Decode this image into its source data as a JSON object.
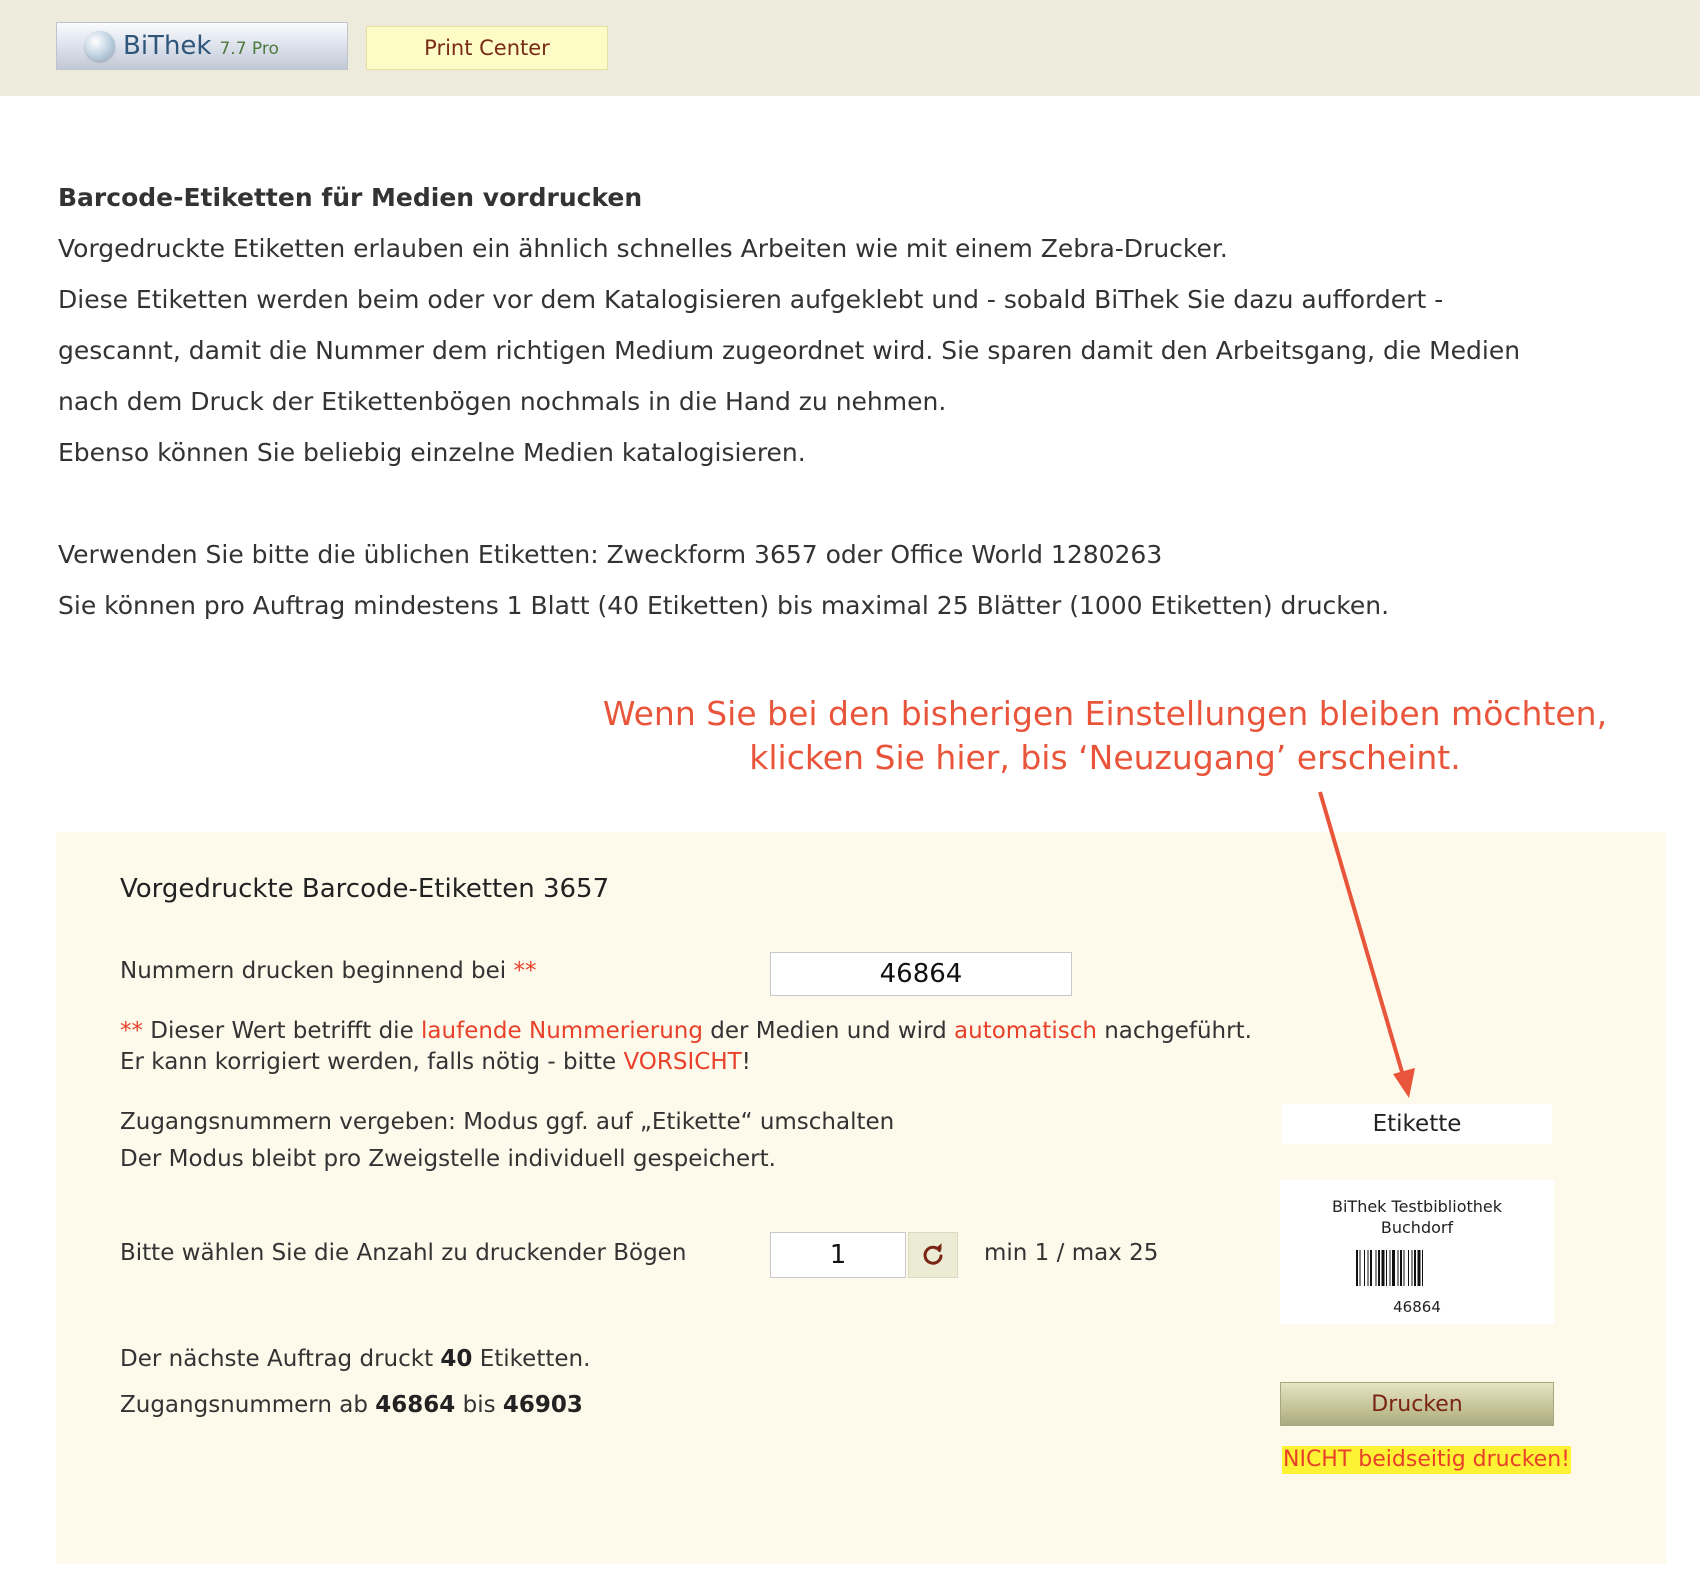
{
  "header": {
    "logo_name": "BiThek",
    "logo_version": "7.7 Pro",
    "print_center_label": "Print Center"
  },
  "intro": {
    "heading": "Barcode-Etiketten für Medien vordrucken",
    "line1": "Vorgedruckte Etiketten erlauben ein ähnlich schnelles Arbeiten wie mit einem Zebra-Drucker.",
    "line2": "Diese Etiketten werden beim oder vor dem Katalogisieren aufgeklebt und - sobald BiThek Sie dazu auffordert -",
    "line3": "gescannt, damit die Nummer dem richtigen Medium zugeordnet wird. Sie sparen damit den Arbeitsgang, die Medien",
    "line4": "nach dem Druck der Etikettenbögen nochmals in die Hand zu nehmen.",
    "line5": "Ebenso können Sie beliebig einzelne Medien katalogisieren.",
    "line6": "Verwenden Sie bitte die üblichen Etiketten: Zweckform 3657 oder Office World 1280263",
    "line7": "Sie können pro Auftrag mindestens 1 Blatt (40 Etiketten) bis maximal 25 Blätter (1000 Etiketten) drucken."
  },
  "callout": {
    "line1": "Wenn Sie bei den bisherigen Einstellungen bleiben möchten,",
    "line2": "klicken Sie hier, bis ‘Neuzugang’ erscheint."
  },
  "panel": {
    "title": "Vorgedruckte Barcode-Etiketten 3657",
    "start_label": "Nummern drucken beginnend bei",
    "stars": "**",
    "start_value": "46864",
    "note": {
      "stars": "**",
      "part1": " Dieser Wert betrifft die ",
      "highlight1": "laufende Nummerierung",
      "part2": " der Medien und wird ",
      "highlight2": "automatisch",
      "part3": " nachgeführt.",
      "line2_part1": "Er kann korrigiert werden, falls nötig - bitte ",
      "line2_highlight": "VORSICHT",
      "line2_part2": "!"
    },
    "mode_line1": "Zugangsnummern vergeben: Modus ggf. auf „Etikette“ umschalten",
    "mode_line2": "Der Modus bleibt pro Zweigstelle individuell gespeichert.",
    "mode_value": "Etikette",
    "preview": {
      "library_line1": "BiThek Testbibliothek",
      "library_line2": "Buchdorf",
      "number": "46864"
    },
    "count_label": "Bitte wählen Sie die Anzahl zu druckender Bögen",
    "count_value": "1",
    "minmax": "min 1 / max 25",
    "summary1_pre": "Der nächste Auftrag druckt ",
    "summary1_count": "40",
    "summary1_post": " Etiketten.",
    "summary2_pre": "Zugangsnummern ab ",
    "summary2_from": "46864",
    "summary2_mid": " bis ",
    "summary2_to": "46903",
    "print_button": "Drucken",
    "warning": "NICHT beidseitig drucken!"
  },
  "colors": {
    "accent_red": "#e8402a",
    "callout_orange": "#e8553a",
    "panel_bg": "#fdf9eb",
    "topbar_bg": "#ecebdc",
    "warning_bg": "#fdf234"
  },
  "icons": {
    "reload": "reload-icon",
    "logo": "bithek-logo-icon",
    "arrow": "callout-arrow-icon"
  }
}
